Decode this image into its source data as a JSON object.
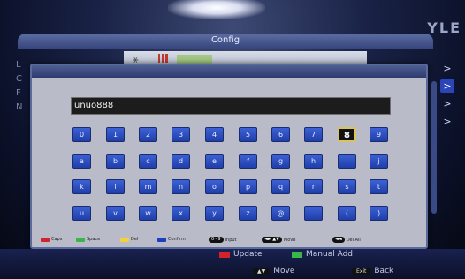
{
  "window": {
    "title": "Config",
    "brand": "YLE"
  },
  "left_menu_letters": [
    "L",
    "C",
    "F",
    "N"
  ],
  "right_menu": [
    "chevron-right",
    "chevron-right",
    "chevron-right",
    "chevron-right"
  ],
  "dialog": {
    "input_value": "unuo888",
    "selected_key": "8",
    "rows": [
      [
        "0",
        "1",
        "2",
        "3",
        "4",
        "5",
        "6",
        "7",
        "8",
        "9"
      ],
      [
        "a",
        "b",
        "c",
        "d",
        "e",
        "f",
        "g",
        "h",
        "i",
        "j"
      ],
      [
        "k",
        "l",
        "m",
        "n",
        "o",
        "p",
        "q",
        "r",
        "s",
        "t"
      ],
      [
        "u",
        "v",
        "w",
        "x",
        "y",
        "z",
        "@",
        ".",
        "(",
        ")"
      ]
    ],
    "legend": {
      "caps": "Caps",
      "space": "Space",
      "del": "Del",
      "confirm": "Confirm",
      "input_key": "0~9",
      "input": "Input",
      "move_keys": "◄► ▲▼",
      "move": "Move",
      "delall_key": "◄◄",
      "delall": "Del All"
    }
  },
  "bottom": {
    "update": "Update",
    "manual_add": "Manual Add",
    "move_key": "▲▼",
    "move": "Move",
    "exit_key": "Exit",
    "back": "Back"
  },
  "colors": {
    "red": "#d2232a",
    "green": "#39b54a",
    "yellow": "#f2d13a",
    "blue": "#1b3fbf",
    "key_blue": "#2a4ec0",
    "selected_border": "#d9c35a"
  }
}
